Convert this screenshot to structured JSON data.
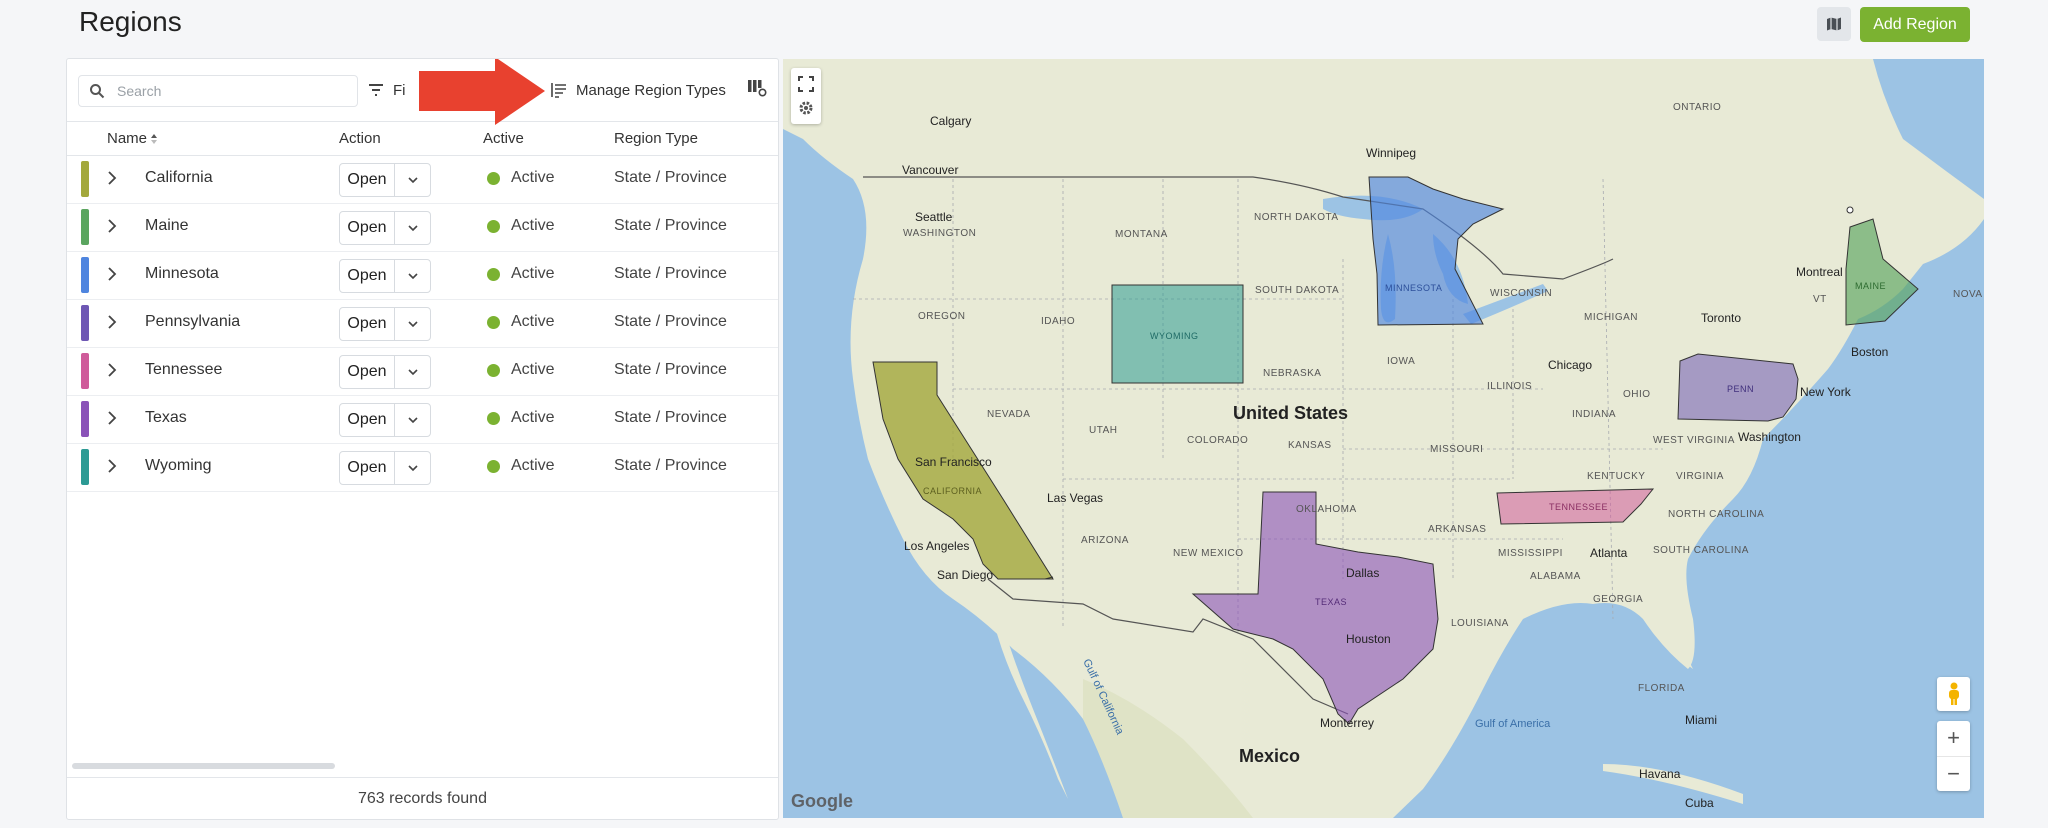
{
  "header": {
    "title": "Regions",
    "add_label": "Add Region",
    "map_icon": "map-icon"
  },
  "toolbar": {
    "search_placeholder": "Search",
    "filter_label": "Fi",
    "manage_label": "Manage Region Types"
  },
  "table": {
    "columns": [
      "Name",
      "Action",
      "Active",
      "Region Type"
    ],
    "sort_column": "Name",
    "rows": [
      {
        "name": "California",
        "action": "Open",
        "status": "Active",
        "type": "State / Province",
        "color": "#a3a83c"
      },
      {
        "name": "Maine",
        "action": "Open",
        "status": "Active",
        "type": "State / Province",
        "color": "#5aa55f"
      },
      {
        "name": "Minnesota",
        "action": "Open",
        "status": "Active",
        "type": "State / Province",
        "color": "#4f85df"
      },
      {
        "name": "Pennsylvania",
        "action": "Open",
        "status": "Active",
        "type": "State / Province",
        "color": "#6e57b4"
      },
      {
        "name": "Tennessee",
        "action": "Open",
        "status": "Active",
        "type": "State / Province",
        "color": "#cf5b9a"
      },
      {
        "name": "Texas",
        "action": "Open",
        "status": "Active",
        "type": "State / Province",
        "color": "#8a52b8"
      },
      {
        "name": "Wyoming",
        "action": "Open",
        "status": "Active",
        "type": "State / Province",
        "color": "#2c9a94"
      }
    ],
    "footer": "763 records found"
  },
  "map": {
    "country_labels": [
      "United States",
      "Mexico"
    ],
    "region_labels": [
      "WYOMING",
      "MINNESOTA",
      "MAINE",
      "PENN",
      "CALIFORNIA",
      "TEXAS",
      "TENNESSEE"
    ],
    "state_labels": [
      "WASHINGTON",
      "MONTANA",
      "NORTH DAKOTA",
      "SOUTH DAKOTA",
      "OREGON",
      "IDAHO",
      "NEBRASKA",
      "IOWA",
      "WISCONSIN",
      "MICHIGAN",
      "ILLINOIS",
      "INDIANA",
      "OHIO",
      "NEVADA",
      "UTAH",
      "COLORADO",
      "KANSAS",
      "MISSOURI",
      "KENTUCKY",
      "WEST VIRGINIA",
      "VIRGINIA",
      "ARIZONA",
      "NEW MEXICO",
      "OKLAHOMA",
      "ARKANSAS",
      "NORTH CAROLINA",
      "SOUTH CAROLINA",
      "MISSISSIPPI",
      "ALABAMA",
      "GEORGIA",
      "LOUISIANA",
      "FLORIDA",
      "ONTARIO",
      "NOVA",
      "VT"
    ],
    "cities": [
      "Calgary",
      "Winnipeg",
      "Vancouver",
      "Seattle",
      "Montreal",
      "Toronto",
      "Boston",
      "New York",
      "Chicago",
      "Washington",
      "San Francisco",
      "Las Vegas",
      "Los Angeles",
      "San Diego",
      "Dallas",
      "Houston",
      "Atlanta",
      "Monterrey",
      "Miami",
      "Havana",
      "Cuba"
    ],
    "water_labels": [
      "Gulf of California",
      "Gulf of America"
    ],
    "attribution": "Google",
    "zoom_in": "+",
    "zoom_out": "−"
  }
}
